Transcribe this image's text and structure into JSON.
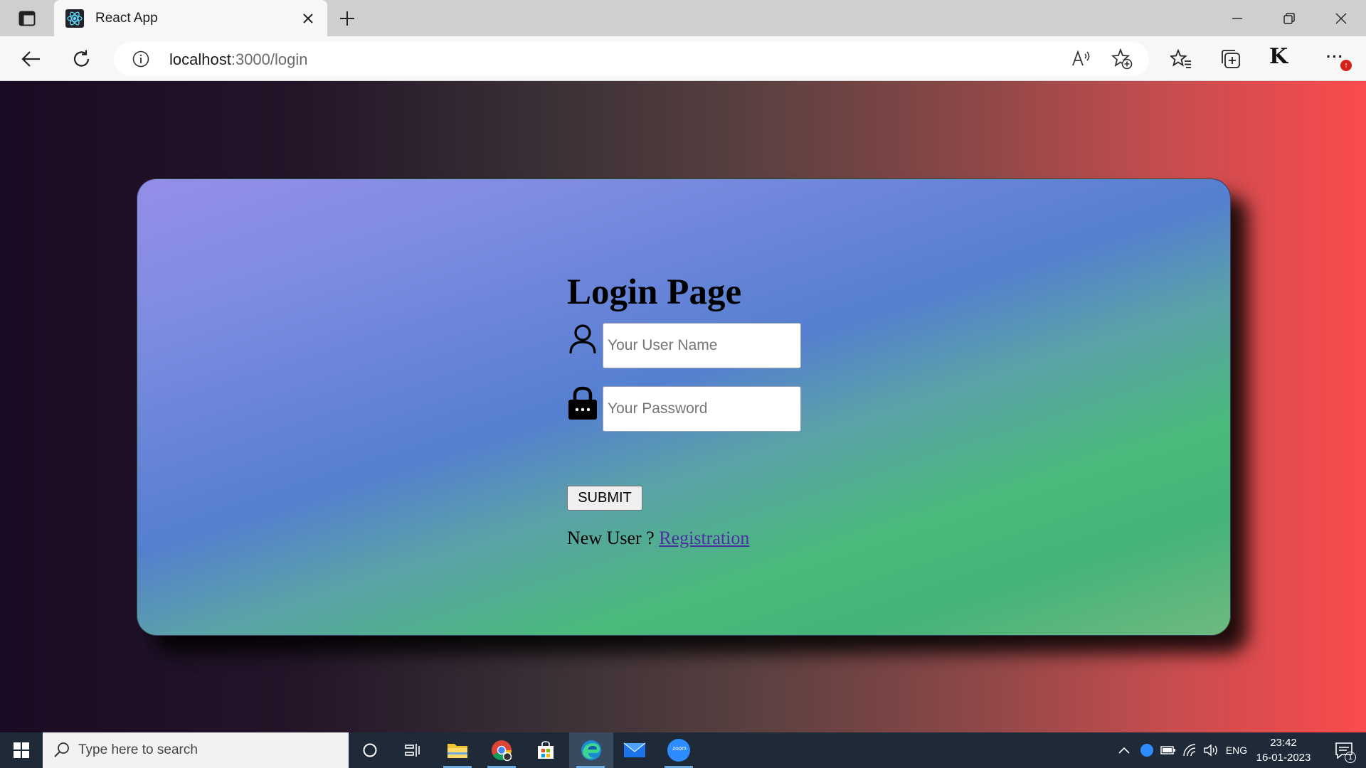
{
  "browser": {
    "tab_title": "React App",
    "address": {
      "host": "localhost",
      "path": ":3000/login"
    },
    "profile_initials": "K",
    "more_label": "···",
    "notification_badge": "↑"
  },
  "page": {
    "title": "Login Page",
    "username_placeholder": "Your User Name",
    "username_value": "",
    "password_placeholder": "Your Password",
    "password_value": "",
    "submit_label": "SUBMIT",
    "new_user_text": "New User ? ",
    "register_link": "Registration"
  },
  "taskbar": {
    "search_placeholder": "Type here to search",
    "language": "ENG",
    "time": "23:42",
    "date": "16-01-2023",
    "notification_count": "1",
    "zoom_label": "zoom"
  },
  "colors": {
    "page_gradient_left": "#1a0b24",
    "page_gradient_right": "#fb4b4d",
    "card_top": "#948ee9",
    "card_mid": "#557fcf",
    "card_bottom": "#45b37a",
    "link": "#4b2ea0",
    "taskbar": "#1f2a38"
  },
  "icons": {
    "tab_actions": "tab-actions-icon",
    "favicon": "react-logo-icon",
    "back": "back-arrow-icon",
    "refresh": "refresh-icon",
    "site_info": "info-icon",
    "read_aloud": "read-aloud-icon",
    "add_favorite": "add-favorite-icon",
    "favorites": "favorites-icon",
    "collections": "collections-icon",
    "user_field": "user-icon",
    "password_field": "lock-icon"
  }
}
